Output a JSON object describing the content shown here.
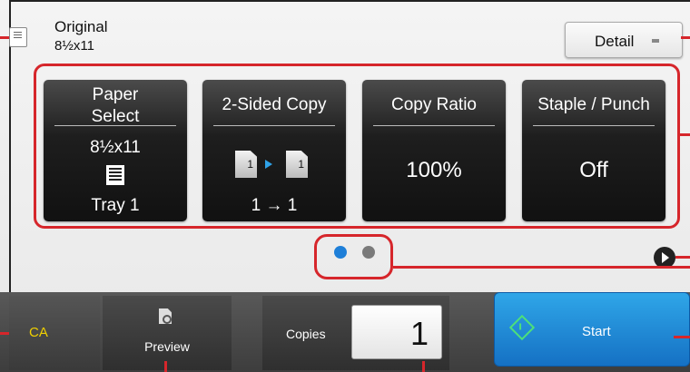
{
  "original": {
    "title": "Original",
    "size": "8½x11",
    "icon": "original-document-icon"
  },
  "detail_button": {
    "label": "Detail"
  },
  "functions": [
    {
      "title_line1": "Paper",
      "title_line2": "Select",
      "value": "8½x11",
      "sub": "Tray 1",
      "icon": "paper-tray-icon"
    },
    {
      "title": "2-Sided Copy",
      "icon_left": "1",
      "icon_right": "1",
      "value": "1 → 1",
      "icon": "duplex-icon"
    },
    {
      "title": "Copy Ratio",
      "value": "100%"
    },
    {
      "title": "Staple / Punch",
      "value": "Off"
    }
  ],
  "pager": {
    "page": 1,
    "total": 2
  },
  "bottom": {
    "ca_label": "CA",
    "preview_label": "Preview",
    "copies_label": "Copies",
    "copies_value": "1",
    "start_label": "Start"
  },
  "colors": {
    "callout": "#d6262b",
    "start": "#1f8bd6",
    "dot_active": "#1e7fd8",
    "dot_inactive": "#7a7a7a",
    "ca_text": "#f0d000"
  }
}
